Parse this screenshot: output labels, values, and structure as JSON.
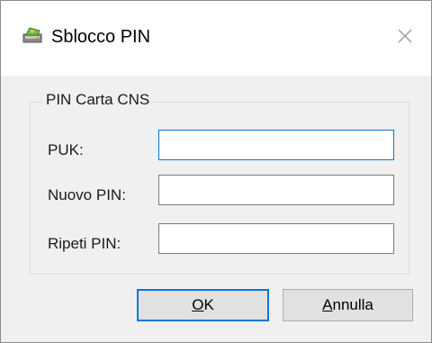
{
  "window": {
    "title": "Sblocco PIN",
    "title_icon": "card-reader-icon",
    "close_icon": "close-icon"
  },
  "group": {
    "legend": "PIN Carta CNS"
  },
  "fields": {
    "puk": {
      "label": "PUK:",
      "value": ""
    },
    "nuovo_pin": {
      "label": "Nuovo PIN:",
      "value": ""
    },
    "ripeti_pin": {
      "label": "Ripeti PIN:",
      "value": ""
    }
  },
  "buttons": {
    "ok": {
      "mnemonic": "O",
      "rest": "K"
    },
    "annulla": {
      "mnemonic": "A",
      "rest": "nnulla"
    }
  },
  "colors": {
    "accent": "#0078d7",
    "dialog_bg": "#f0f0f0",
    "titlebar_bg": "#ffffff",
    "button_bg": "#e1e1e1"
  }
}
